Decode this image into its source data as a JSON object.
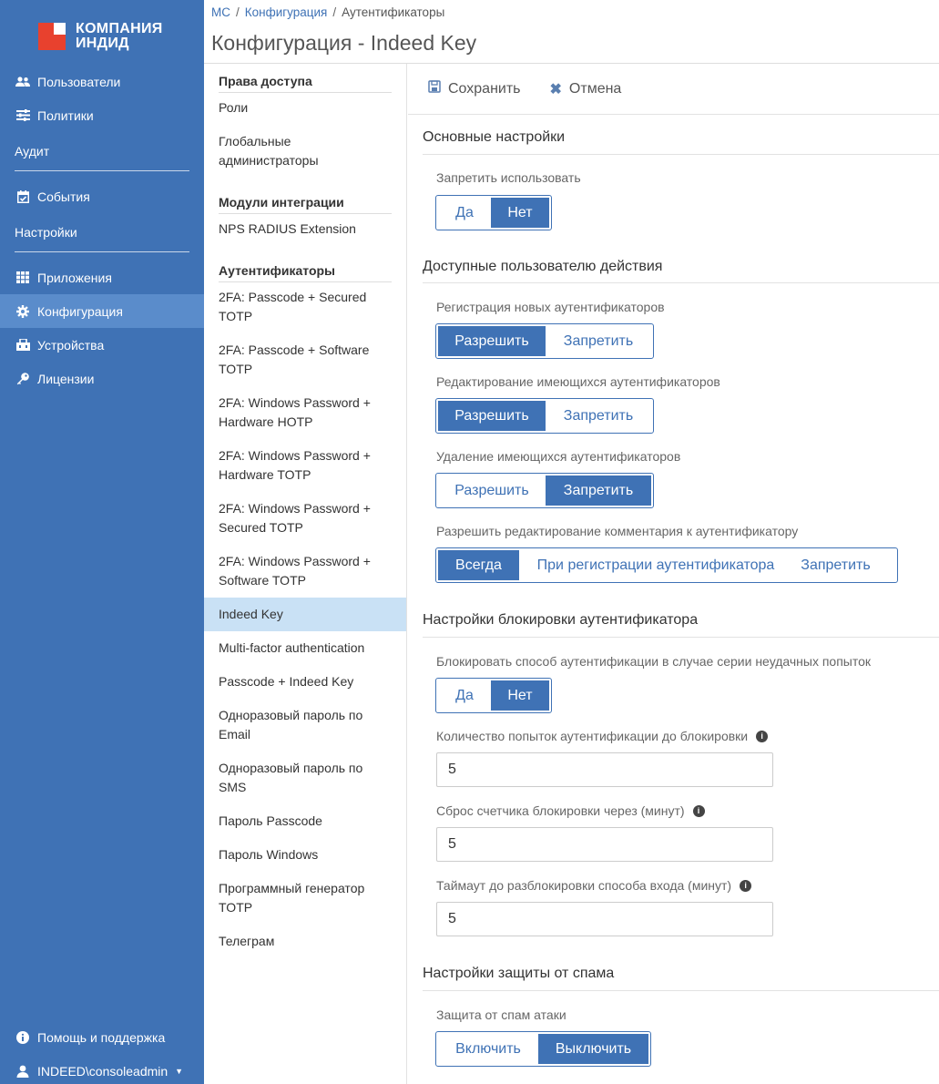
{
  "brand": {
    "line1": "КОМПАНИЯ",
    "line2": "ИНДИД"
  },
  "sidebar": {
    "items": [
      {
        "label": "Пользователи",
        "icon": "users-icon"
      },
      {
        "label": "Политики",
        "icon": "sliders-icon"
      },
      {
        "label": "События",
        "icon": "calendar-check-icon"
      },
      {
        "label": "Приложения",
        "icon": "grid-icon"
      },
      {
        "label": "Конфигурация",
        "icon": "gear-icon",
        "active": true
      },
      {
        "label": "Устройства",
        "icon": "devices-icon"
      },
      {
        "label": "Лицензии",
        "icon": "key-icon"
      }
    ],
    "sections": {
      "audit": "Аудит",
      "settings": "Настройки"
    },
    "footer": {
      "help": "Помощь и поддержка",
      "user": "INDEED\\consoleadmin"
    }
  },
  "breadcrumb": {
    "root": "МС",
    "parent": "Конфигурация",
    "current": "Аутентификаторы"
  },
  "page_title": "Конфигурация - Indeed Key",
  "midlist": {
    "access_header": "Права доступа",
    "roles": "Роли",
    "global_admins_1": "Глобальные",
    "global_admins_2": "администраторы",
    "integration_header": "Модули интеграции",
    "nps": "NPS RADIUS Extension",
    "auth_header": "Аутентификаторы",
    "items": [
      [
        "2FA: Passcode + Secured",
        "TOTP"
      ],
      [
        "2FA: Passcode + Software",
        "TOTP"
      ],
      [
        "2FA: Windows Password +",
        "Hardware HOTP"
      ],
      [
        "2FA: Windows Password +",
        "Hardware TOTP"
      ],
      [
        "2FA: Windows Password +",
        "Secured TOTP"
      ],
      [
        "2FA: Windows Password +",
        "Software TOTP"
      ],
      [
        "Indeed Key"
      ],
      [
        "Multi-factor authentication"
      ],
      [
        "Passcode + Indeed Key"
      ],
      [
        "Одноразовый пароль по",
        "Email"
      ],
      [
        "Одноразовый пароль по",
        "SMS"
      ],
      [
        "Пароль Passcode"
      ],
      [
        "Пароль Windows"
      ],
      [
        "Программный генератор",
        "TOTP"
      ],
      [
        "Телеграм"
      ]
    ]
  },
  "toolbar": {
    "save": "Сохранить",
    "cancel": "Отмена"
  },
  "sections": {
    "basic": {
      "title": "Основные настройки",
      "forbid_label": "Запретить использовать",
      "yes": "Да",
      "no": "Нет",
      "selected": "Нет"
    },
    "actions": {
      "title": "Доступные пользователю действия",
      "register_label": "Регистрация новых аутентификаторов",
      "edit_label": "Редактирование имеющихся аутентификаторов",
      "delete_label": "Удаление имеющихся аутентификаторов",
      "allow": "Разрешить",
      "deny": "Запретить",
      "register_selected": "Разрешить",
      "edit_selected": "Разрешить",
      "delete_selected": "Запретить",
      "comment_label": "Разрешить редактирование комментария к аутентификатору",
      "always": "Всегда",
      "on_register": "При регистрации аутентификатора",
      "comment_deny": "Запретить",
      "comment_selected": "Всегда"
    },
    "lockout": {
      "title": "Настройки блокировки аутентификатора",
      "block_label": "Блокировать способ аутентификации в случае серии неудачных попыток",
      "yes": "Да",
      "no": "Нет",
      "selected": "Нет",
      "attempts_label": "Количество попыток аутентификации до блокировки",
      "attempts_value": "5",
      "reset_label": "Сброс счетчика блокировки через (минут)",
      "reset_value": "5",
      "timeout_label": "Таймаут до разблокировки способа входа (минут)",
      "timeout_value": "5"
    },
    "spam": {
      "title": "Настройки защиты от спама",
      "protection_label": "Защита от спам атаки",
      "enable": "Включить",
      "disable": "Выключить",
      "selected": "Выключить"
    }
  },
  "colors": {
    "sidebar": "#3f72b5",
    "sidebar_active": "#5a8ccb",
    "accent": "#3f72b5",
    "logo_red": "#e8412e",
    "selected_row": "#c9e1f5"
  }
}
